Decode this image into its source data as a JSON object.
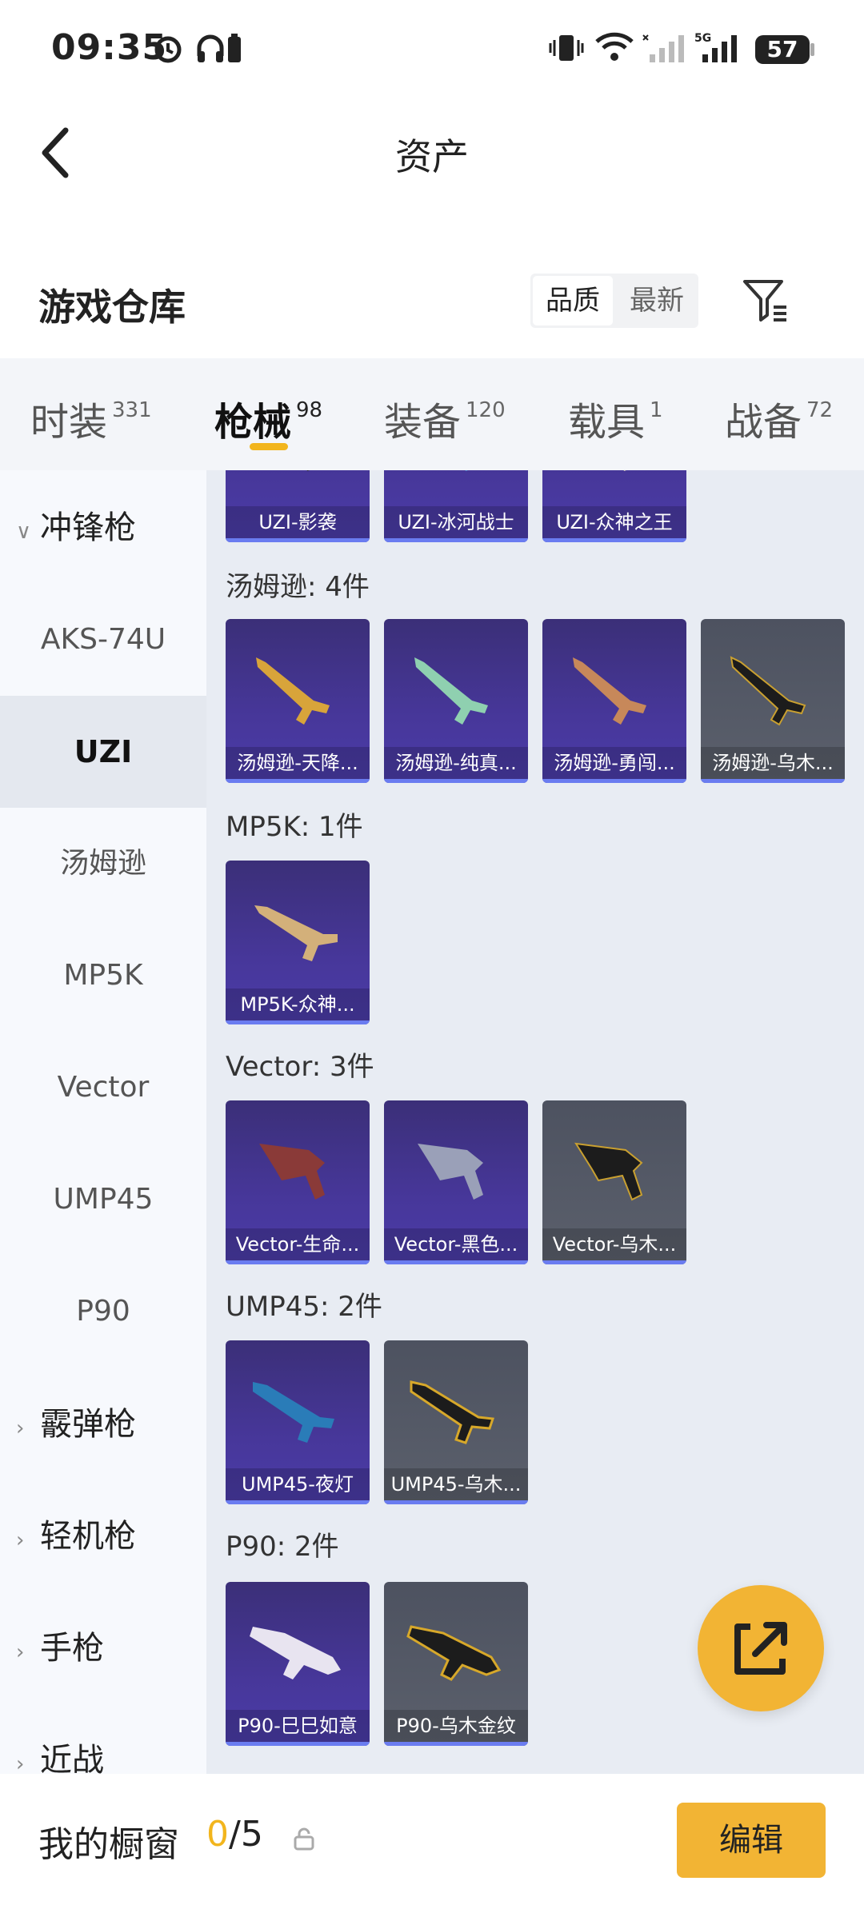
{
  "status": {
    "time": "09:35",
    "battery": "57"
  },
  "nav": {
    "title": "资产"
  },
  "header": {
    "title": "游戏仓库",
    "sort_quality": "品质",
    "sort_newest": "最新"
  },
  "tabs": [
    {
      "label": "时装",
      "count": "331"
    },
    {
      "label": "枪械",
      "count": "98"
    },
    {
      "label": "装备",
      "count": "120"
    },
    {
      "label": "载具",
      "count": "1"
    },
    {
      "label": "战备",
      "count": "72"
    }
  ],
  "sidebar": {
    "cat_smg": "冲锋枪",
    "items": [
      "AKS-74U",
      "UZI",
      "汤姆逊",
      "MP5K",
      "Vector",
      "UMP45",
      "P90"
    ],
    "cat_shotgun": "霰弹枪",
    "cat_lmg": "轻机枪",
    "cat_pistol": "手枪",
    "cat_melee": "近战"
  },
  "groups": {
    "uzi": {
      "items": [
        "UZI-影袭",
        "UZI-冰河战士",
        "UZI-众神之王"
      ]
    },
    "thompson": {
      "title": "汤姆逊: 4件",
      "items": [
        "汤姆逊-天降...",
        "汤姆逊-纯真...",
        "汤姆逊-勇闯...",
        "汤姆逊-乌木..."
      ]
    },
    "mp5k": {
      "title": "MP5K: 1件",
      "items": [
        "MP5K-众神..."
      ]
    },
    "vector": {
      "title": "Vector: 3件",
      "items": [
        "Vector-生命...",
        "Vector-黑色...",
        "Vector-乌木..."
      ]
    },
    "ump45": {
      "title": "UMP45: 2件",
      "items": [
        "UMP45-夜灯",
        "UMP45-乌木..."
      ]
    },
    "p90": {
      "title": "P90: 2件",
      "items": [
        "P90-巳巳如意",
        "P90-乌木金纹"
      ]
    }
  },
  "bottom": {
    "title": "我的橱窗",
    "current": "0",
    "total": "/5",
    "edit": "编辑"
  },
  "colors": {
    "accent": "#f2b434",
    "card_purple": "#47379a",
    "card_gray": "#575c68"
  },
  "icons": [
    "back-arrow-icon",
    "filter-icon",
    "share-external-icon",
    "lock-icon",
    "chevron-down-icon",
    "chevron-right-icon"
  ]
}
